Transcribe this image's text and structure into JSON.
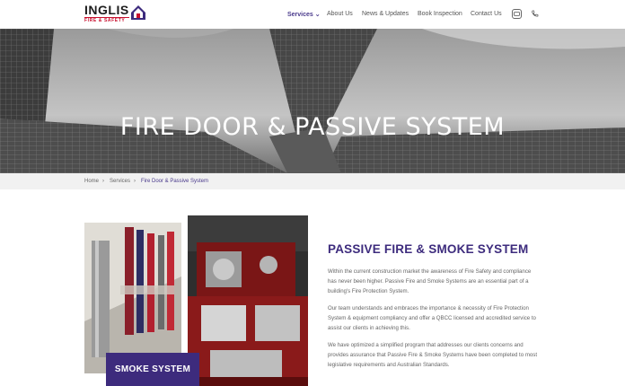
{
  "header": {
    "logo_main": "INGLIS",
    "logo_sub": "FIRE & SAFETY",
    "nav": [
      "Services",
      "About Us",
      "News & Updates",
      "Book Inspection",
      "Contact Us"
    ],
    "nav_dropdown_glyph": "⌄",
    "icons": [
      "chat-icon",
      "phone-icon"
    ]
  },
  "hero": {
    "title": "FIRE DOOR & PASSIVE SYSTEM"
  },
  "breadcrumb": {
    "items": [
      "Home",
      "Services",
      "Fire Door & Passive System"
    ],
    "separator": "›"
  },
  "content": {
    "badge": "SMOKE SYSTEM",
    "title": "PASSIVE FIRE & SMOKE SYSTEM",
    "paragraphs": [
      "Within the current construction market the awareness of Fire Safety and compliance has never been higher. Passive Fire and Smoke Systems are an essential part of a building's Fire Protection System.",
      "Our team understands and embraces the importance & necessity of Fire Protection System & equipment compliancy and offer a QBCC licensed and accredited service to assist our clients in achieving this.",
      "We have optimized a simplified program that addresses our clients concerns and provides assurance that Passive Fire & Smoke Systems have been completed to most legislative requirements and Australian Standards."
    ]
  },
  "colors": {
    "brand_purple": "#3d2b7d",
    "brand_red": "#c8102e"
  }
}
